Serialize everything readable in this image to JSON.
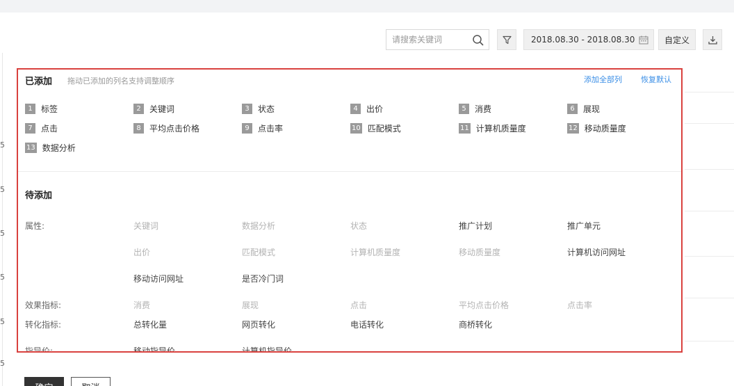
{
  "toolbar": {
    "search_placeholder": "请搜索关键词",
    "date_range": "2018.08.30 - 2018.08.30",
    "custom_label": "自定义"
  },
  "added": {
    "title": "已添加",
    "hint": "拖动已添加的列名支持调整顺序",
    "add_all_label": "添加全部列",
    "restore_label": "恢复默认",
    "items": [
      {
        "num": "1",
        "label": "标签"
      },
      {
        "num": "2",
        "label": "关键词"
      },
      {
        "num": "3",
        "label": "状态"
      },
      {
        "num": "4",
        "label": "出价"
      },
      {
        "num": "5",
        "label": "消费"
      },
      {
        "num": "6",
        "label": "展现"
      },
      {
        "num": "7",
        "label": "点击"
      },
      {
        "num": "8",
        "label": "平均点击价格"
      },
      {
        "num": "9",
        "label": "点击率"
      },
      {
        "num": "10",
        "label": "匹配模式"
      },
      {
        "num": "11",
        "label": "计算机质量度"
      },
      {
        "num": "12",
        "label": "移动质量度"
      },
      {
        "num": "13",
        "label": "数据分析"
      }
    ]
  },
  "pending": {
    "title": "待添加",
    "categories": [
      {
        "label": "属性:",
        "options": [
          {
            "label": "关键词",
            "enabled": false
          },
          {
            "label": "数据分析",
            "enabled": false
          },
          {
            "label": "状态",
            "enabled": false
          },
          {
            "label": "推广计划",
            "enabled": true
          },
          {
            "label": "推广单元",
            "enabled": true
          },
          {
            "label": "出价",
            "enabled": false
          },
          {
            "label": "匹配模式",
            "enabled": false
          },
          {
            "label": "计算机质量度",
            "enabled": false
          },
          {
            "label": "移动质量度",
            "enabled": false
          },
          {
            "label": "计算机访问网址",
            "enabled": true
          },
          {
            "label": "移动访问网址",
            "enabled": true
          },
          {
            "label": "是否冷门词",
            "enabled": true
          }
        ]
      },
      {
        "label": "效果指标:",
        "options": [
          {
            "label": "消费",
            "enabled": false
          },
          {
            "label": "展现",
            "enabled": false
          },
          {
            "label": "点击",
            "enabled": false
          },
          {
            "label": "平均点击价格",
            "enabled": false
          },
          {
            "label": "点击率",
            "enabled": false
          }
        ]
      },
      {
        "label": "转化指标:",
        "options": [
          {
            "label": "总转化量",
            "enabled": true
          },
          {
            "label": "网页转化",
            "enabled": true
          },
          {
            "label": "电话转化",
            "enabled": true
          },
          {
            "label": "商桥转化",
            "enabled": true
          }
        ]
      },
      {
        "label": "指导价:",
        "options": [
          {
            "label": "移动指导价",
            "enabled": true
          },
          {
            "label": "计算机指导价",
            "enabled": true
          }
        ]
      }
    ]
  },
  "footer": {
    "ok_label": "确定",
    "cancel_label": "取消"
  },
  "background": {
    "row_marks": [
      "5",
      "5",
      "5",
      "5",
      "5",
      "5"
    ]
  },
  "colors": {
    "highlight_border": "#d9413e",
    "link": "#3a8ee6",
    "chip_number_bg": "#9a9a9a"
  }
}
